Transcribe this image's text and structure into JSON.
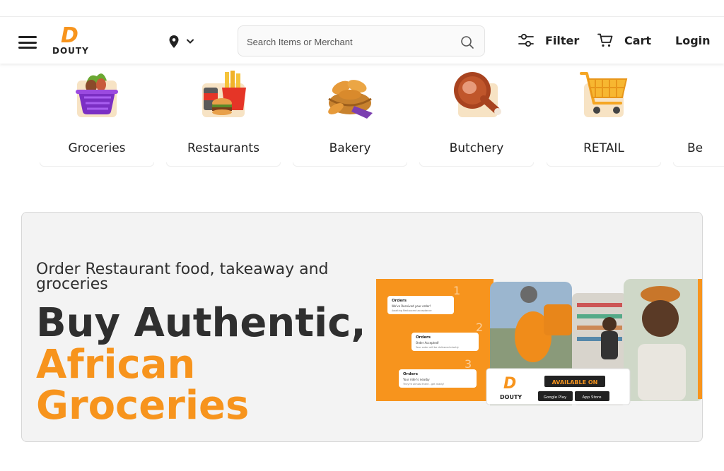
{
  "brand": {
    "name": "DOUTY",
    "initial": "D",
    "accent": "#f7941d"
  },
  "search": {
    "placeholder": "Search Items or Merchant"
  },
  "nav": {
    "filter": "Filter",
    "cart": "Cart",
    "login": "Login"
  },
  "icons": [
    "menu-icon",
    "location-pin-icon",
    "chevron-down-icon",
    "search-icon",
    "filter-sliders-icon",
    "cart-icon"
  ],
  "categories": [
    {
      "label": "Groceries",
      "icon": "grocery-basket-icon"
    },
    {
      "label": "Restaurants",
      "icon": "fast-food-icon"
    },
    {
      "label": "Bakery",
      "icon": "bread-basket-icon"
    },
    {
      "label": "Butchery",
      "icon": "meat-icon"
    },
    {
      "label": "RETAIL",
      "icon": "shopping-cart-icon"
    },
    {
      "label": "Be",
      "icon": ""
    }
  ],
  "banner": {
    "subtitle": "Order Restaurant food, takeaway and groceries",
    "headline_line1": "Buy Authentic,",
    "headline_line2": "African",
    "headline_line3": "Groceries",
    "promo": {
      "available_on": "AVAILABLE ON",
      "google_play": "Google Play",
      "app_store": "App Store",
      "orders": [
        {
          "title": "Orders",
          "line1": "We've Received your order!",
          "line2": "Awaiting Restaurant acceptance",
          "step": "1"
        },
        {
          "title": "Orders",
          "line1": "Order Accepted!",
          "line2": "Your order will be delivered shortly",
          "step": "2"
        },
        {
          "title": "Orders",
          "line1": "Your rider's nearby",
          "line2": "They're almost there - get ready!",
          "step": "3"
        }
      ]
    }
  }
}
